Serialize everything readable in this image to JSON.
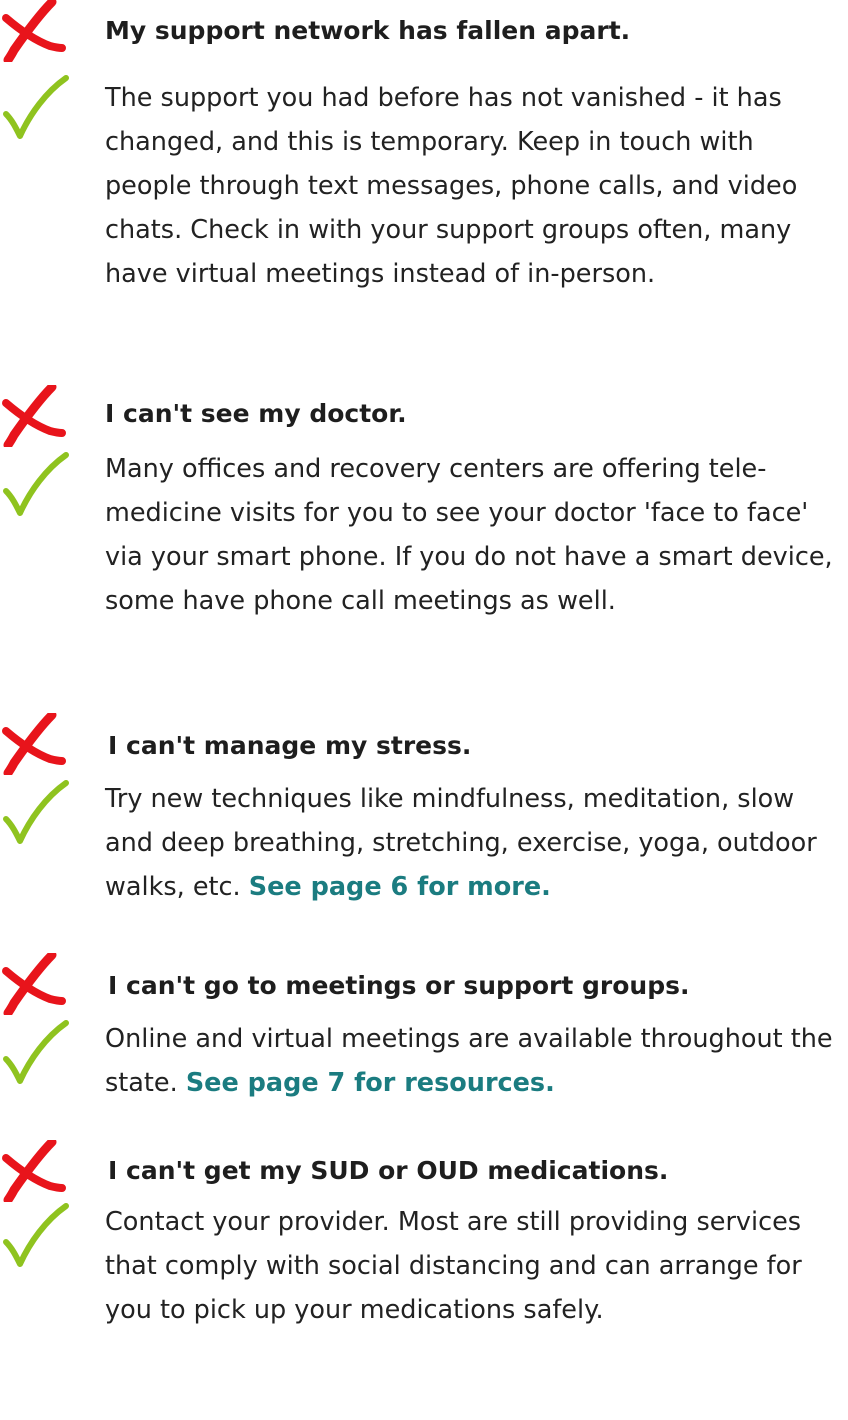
{
  "items": [
    {
      "myth": "My support network has fallen apart.",
      "fact": "The support you had before has not vanished - it has changed, and this is temporary. Keep in touch with people through text messages, phone calls, and video chats. Check in with your support groups often, many have virtual meetings instead of in-person.",
      "link": ""
    },
    {
      "myth": "I can't see my doctor.",
      "fact": "Many offices and recovery centers are offering tele-medicine visits for you to see your doctor 'face to face' via your smart phone. If you do not have a smart device, some have phone call meetings as well.",
      "link": ""
    },
    {
      "myth": "I can't manage my stress.",
      "fact": "Try new techniques like mindfulness, meditation, slow and deep breathing, stretching, exercise, yoga, outdoor walks, etc.",
      "link": "See page 6 for more."
    },
    {
      "myth": "I can't go to meetings or support groups.",
      "fact": "Online and virtual meetings are available throughout the state.",
      "link": "See page 7 for resources."
    },
    {
      "myth": "I can't get my SUD or OUD medications.",
      "fact": "Contact your provider. Most are still providing services that comply with social distancing and can arrange for you to pick up your medications safely.",
      "link": ""
    }
  ],
  "colors": {
    "cross": "#e8141b",
    "check": "#8fc31f",
    "link": "#1b7c80"
  },
  "icons": {
    "myth": "cross-icon",
    "fact": "checkmark-icon"
  }
}
